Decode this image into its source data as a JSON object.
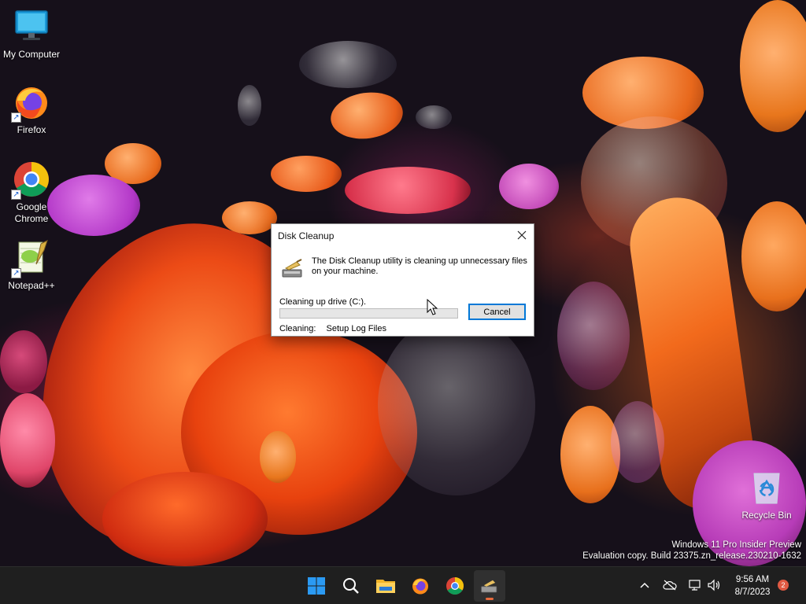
{
  "desktop": {
    "icons": [
      {
        "label": "My Computer",
        "icon": "monitor-icon"
      },
      {
        "label": "Firefox",
        "icon": "firefox-icon"
      },
      {
        "label": "Google Chrome",
        "icon": "chrome-icon"
      },
      {
        "label": "Notepad++",
        "icon": "notepad-plus-plus-icon"
      },
      {
        "label": "Recycle Bin",
        "icon": "recycle-bin-icon"
      }
    ],
    "shortcut_arrow": "↗",
    "watermark": {
      "line1": "Windows 11 Pro Insider Preview",
      "line2": "Evaluation copy. Build 23375.zn_release.230210-1632"
    }
  },
  "dialog": {
    "title": "Disk Cleanup",
    "message": "The Disk Cleanup utility is cleaning up unnecessary files on your machine.",
    "drive_text": "Cleaning up drive  (C:).",
    "progress": 0,
    "cancel_label": "Cancel",
    "status_label": "Cleaning:",
    "status_value": "Setup Log Files",
    "close_glyph": "✕"
  },
  "taskbar": {
    "apps": [
      "start-icon",
      "search-icon",
      "file-explorer-icon",
      "firefox-icon",
      "chrome-icon",
      "disk-cleanup-icon"
    ],
    "active_app": "disk-cleanup-icon",
    "tray": {
      "chevron": "^",
      "time": "9:56 AM",
      "date": "8/7/2023",
      "notification_count": "2"
    }
  },
  "colors": {
    "accent": "#0078d7",
    "taskbar_bg": "#1f1f1f",
    "badge": "#e05a43",
    "active_indicator": "#e86a3c"
  }
}
